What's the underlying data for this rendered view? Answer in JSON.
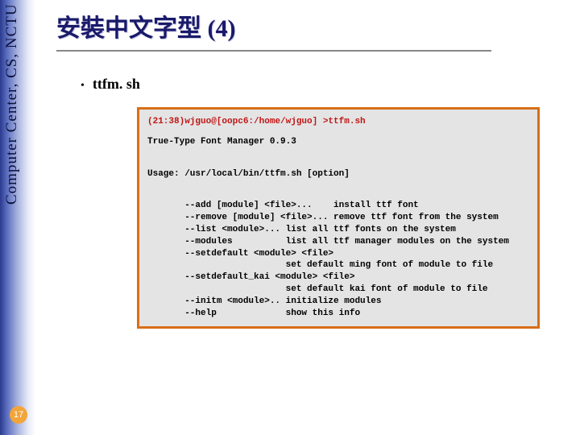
{
  "sidebar": {
    "org": "Computer Center, CS, NCTU"
  },
  "page_number": "17",
  "title": "安裝中文字型 (4)",
  "bullet": "ttfm. sh",
  "term": {
    "prompt": "(21:38)wjguo@[oopc6:/home/wjguo] >ttfm.sh",
    "app": "True-Type Font Manager 0.9.3",
    "usage": "Usage: /usr/local/bin/ttfm.sh [option]",
    "opt_add": "       --add [module] <file>...    install ttf font",
    "opt_remove": "       --remove [module] <file>... remove ttf font from the system",
    "opt_list": "       --list <module>... list all ttf fonts on the system",
    "opt_modules": "       --modules          list all ttf manager modules on the system",
    "opt_setdef1": "       --setdefault <module> <file>",
    "opt_setdef1b": "                          set default ming font of module to file",
    "opt_setdef2": "       --setdefault_kai <module> <file>",
    "opt_setdef2b": "                          set default kai font of module to file",
    "opt_initm": "       --initm <module>.. initialize modules",
    "opt_help": "       --help             show this info"
  }
}
